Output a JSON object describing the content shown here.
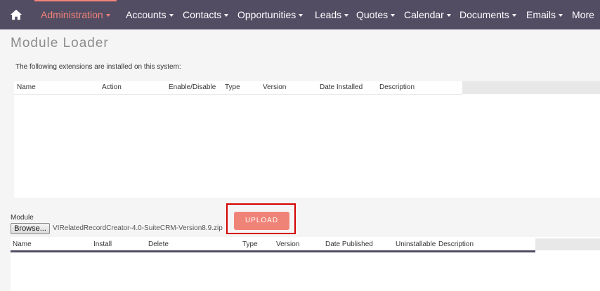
{
  "nav": {
    "home_icon": "home-icon",
    "items": [
      {
        "label": "Administration",
        "active": true
      },
      {
        "label": "Accounts"
      },
      {
        "label": "Contacts"
      },
      {
        "label": "Opportunities"
      },
      {
        "label": "Leads"
      },
      {
        "label": "Quotes"
      },
      {
        "label": "Calendar"
      },
      {
        "label": "Documents"
      },
      {
        "label": "Emails"
      },
      {
        "label": "More"
      }
    ]
  },
  "page": {
    "title": "Module Loader",
    "installed_text": "The following extensions are installed on this system:"
  },
  "installed_table": {
    "columns": [
      "Name",
      "Action",
      "Enable/Disable",
      "Type",
      "Version",
      "Date Installed",
      "Description"
    ]
  },
  "upload": {
    "module_label": "Module",
    "browse_label": "Browse...",
    "file_name": "VIRelatedRecordCreator-4.0-SuiteCRM-Version8.9.zip",
    "upload_label": "UPLOAD"
  },
  "package_table": {
    "columns": [
      "Name",
      "Install",
      "Delete",
      "Type",
      "Version",
      "Date Published",
      "Uninstallable",
      "Description"
    ]
  },
  "colors": {
    "nav_bg": "#534d64",
    "accent": "#f08377",
    "highlight": "#d60000"
  }
}
